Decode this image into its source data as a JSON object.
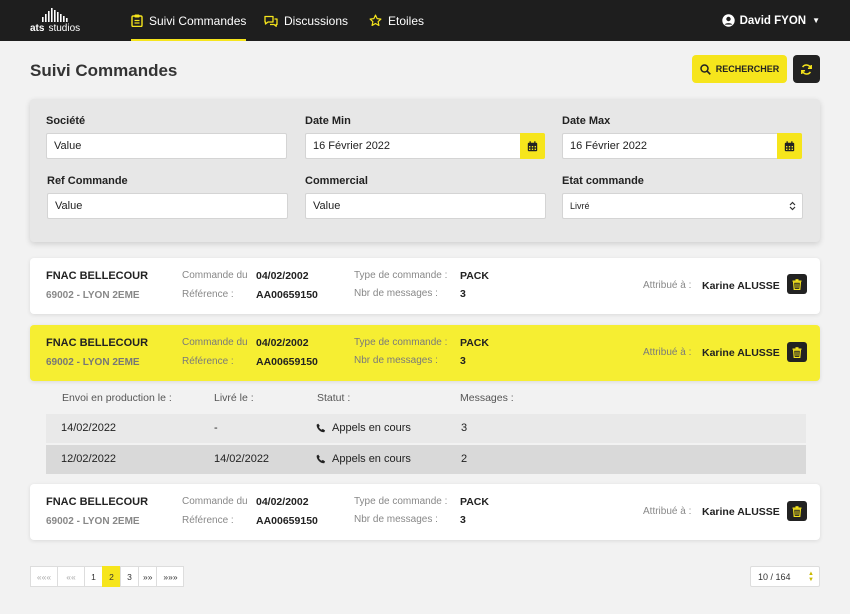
{
  "header": {
    "logo_bold": "ats",
    "logo_rest": "studios",
    "nav": [
      {
        "label": "Suivi Commandes",
        "icon": "clipboard-icon",
        "active": true
      },
      {
        "label": "Discussions",
        "icon": "chat-icon",
        "active": false
      },
      {
        "label": "Etoiles",
        "icon": "star-icon",
        "active": false
      }
    ],
    "user_name": "David FYON"
  },
  "page": {
    "title": "Suivi Commandes",
    "search_label": "RECHERCHER"
  },
  "filters": {
    "societe": {
      "label": "Société",
      "value": "Value"
    },
    "date_min": {
      "label": "Date Min",
      "value": "16 Février 2022"
    },
    "date_max": {
      "label": "Date Max",
      "value": "16 Février 2022"
    },
    "ref_commande": {
      "label": "Ref Commande",
      "value": "Value"
    },
    "commercial": {
      "label": "Commercial",
      "value": "Value"
    },
    "etat": {
      "label": "Etat commande",
      "value": "Livré"
    }
  },
  "card_labels": {
    "commande_du": "Commande du",
    "reference": "Référence :",
    "type": "Type de commande :",
    "nbr_messages": "Nbr de messages :",
    "attribue": "Attribué à :"
  },
  "orders": [
    {
      "company": "FNAC BELLECOUR",
      "city": "69002 - LYON 2EME",
      "date": "04/02/2002",
      "reference": "AA00659150",
      "type": "PACK",
      "messages": "3",
      "assignee": "Karine ALUSSE"
    },
    {
      "company": "FNAC BELLECOUR",
      "city": "69002 - LYON 2EME",
      "date": "04/02/2002",
      "reference": "AA00659150",
      "type": "PACK",
      "messages": "3",
      "assignee": "Karine ALUSSE"
    },
    {
      "company": "FNAC BELLECOUR",
      "city": "69002 - LYON 2EME",
      "date": "04/02/2002",
      "reference": "AA00659150",
      "type": "PACK",
      "messages": "3",
      "assignee": "Karine ALUSSE"
    }
  ],
  "detail": {
    "headers": [
      "Envoi en production le :",
      "Livré le :",
      "Statut :",
      "Messages :"
    ],
    "rows": [
      {
        "production": "14/02/2022",
        "livre": "-",
        "statut": "Appels en cours",
        "messages": "3"
      },
      {
        "production": "12/02/2022",
        "livre": "14/02/2022",
        "statut": "Appels en cours",
        "messages": "2"
      }
    ]
  },
  "pagination": {
    "first": "«««",
    "prev": "««",
    "pages": [
      "1",
      "2",
      "3"
    ],
    "active_page": "2",
    "next": "»»",
    "last": "»»»",
    "count": "10 / 164"
  },
  "colors": {
    "accent": "#f6e51c",
    "dark": "#1e1e1e"
  }
}
